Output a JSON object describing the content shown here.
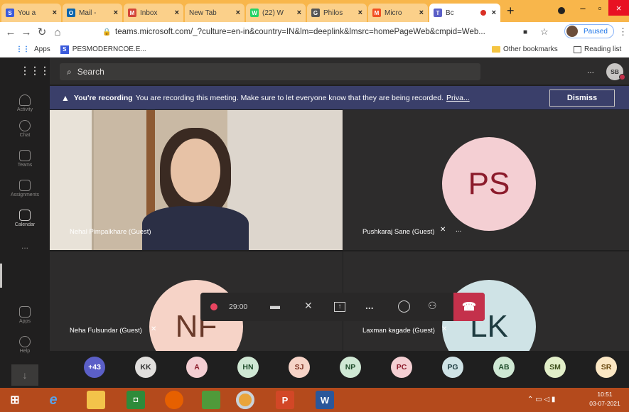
{
  "browser": {
    "tabs": [
      {
        "label": "You a",
        "fav": "S",
        "fav_color": "#3b5bdb"
      },
      {
        "label": "Mail -",
        "fav": "O",
        "fav_color": "#0a64ad"
      },
      {
        "label": "Inbox",
        "fav": "M",
        "fav_color": "#d44638"
      },
      {
        "label": "New Tab",
        "fav": "",
        "fav_color": "#fbd08a"
      },
      {
        "label": "(22) W",
        "fav": "W",
        "fav_color": "#25d366"
      },
      {
        "label": "Philos",
        "fav": "G",
        "fav_color": "#555555"
      },
      {
        "label": "Micro",
        "fav": "M",
        "fav_color": "#f25022"
      },
      {
        "label": "Bc",
        "fav": "T",
        "fav_color": "#5b5fc7"
      }
    ],
    "new_tab": "+",
    "url": "teams.microsoft.com/_?culture=en-in&country=IN&lm=deeplink&lmsrc=homePageWeb&cmpid=Web...",
    "profile_status": "Paused",
    "bookmarks": {
      "apps": "Apps",
      "item1": "PESMODERNCOE.E...",
      "other": "Other bookmarks",
      "reading": "Reading list"
    }
  },
  "teams": {
    "rail": [
      {
        "label": "Activity"
      },
      {
        "label": "Chat"
      },
      {
        "label": "Teams"
      },
      {
        "label": "Assignments"
      },
      {
        "label": "Calendar"
      },
      {
        "label": "Apps"
      },
      {
        "label": "Help"
      }
    ],
    "rail_more": "...",
    "search_placeholder": "Search",
    "user_initials": "SB",
    "more": "...",
    "banner": {
      "title": "You're recording",
      "text": "You are recording this meeting. Make sure to let everyone know that they are being recorded.",
      "link": "Priva...",
      "dismiss": "Dismiss"
    },
    "tiles": [
      {
        "name": "Nehal Pimpalkhare (Guest)"
      },
      {
        "name": "Pushkaraj Sane (Guest)",
        "initials": "PS",
        "more": "..."
      },
      {
        "name": "Neha Fulsundar (Guest)",
        "initials": "NF"
      },
      {
        "name": "Laxman kagade (Guest)",
        "initials": "LK"
      }
    ],
    "callbar": {
      "timer": "29:00",
      "more": "..."
    },
    "participants": [
      "+43",
      "KK",
      "A",
      "HN",
      "SJ",
      "NP",
      "PC",
      "PG",
      "AB",
      "SM",
      "SR"
    ]
  },
  "taskbar": {
    "time": "10:51",
    "date": "03-07-2021"
  }
}
